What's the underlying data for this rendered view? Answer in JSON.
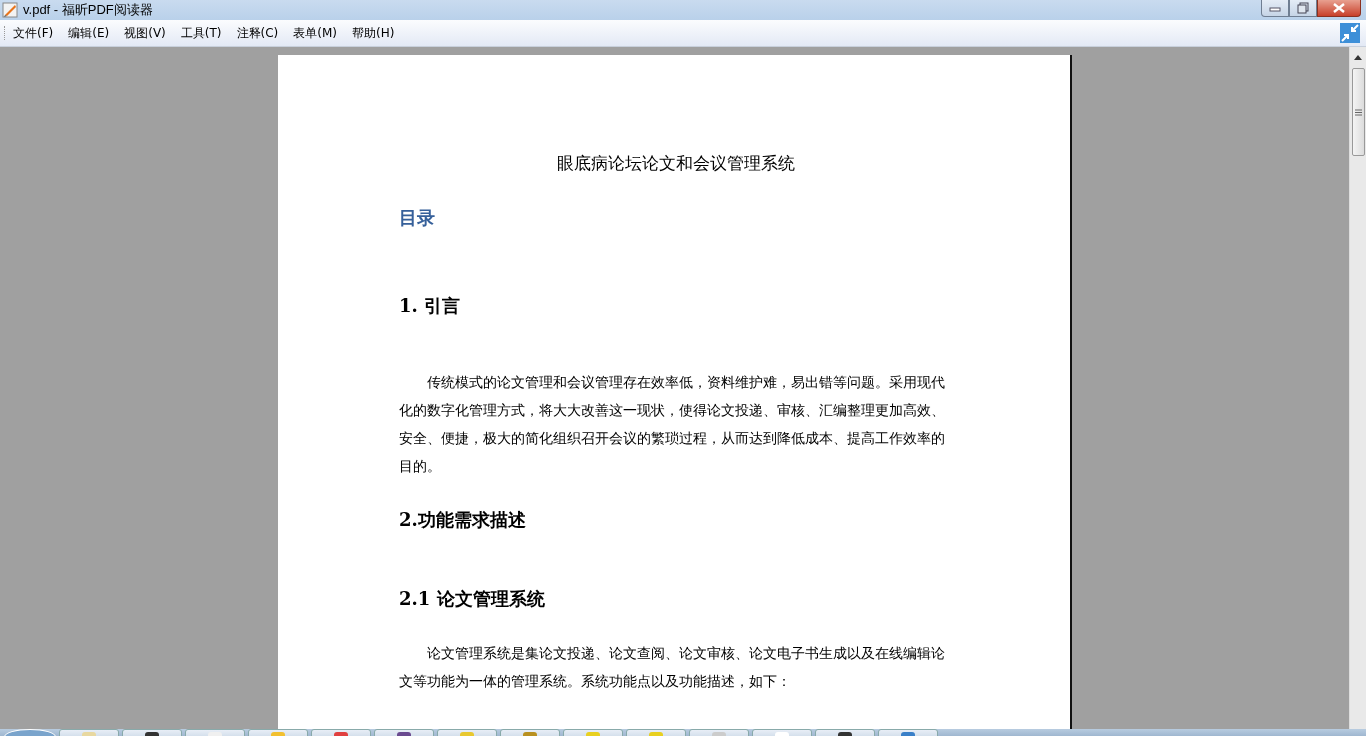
{
  "window": {
    "title": "v.pdf - 福昕PDF阅读器"
  },
  "menu": [
    {
      "label": "文件(F)"
    },
    {
      "label": "编辑(E)"
    },
    {
      "label": "视图(V)"
    },
    {
      "label": "工具(T)"
    },
    {
      "label": "注释(C)"
    },
    {
      "label": "表单(M)"
    },
    {
      "label": "帮助(H)"
    }
  ],
  "document": {
    "title": "眼底病论坛论文和会议管理系统",
    "toc_heading": "目录",
    "blocks": [
      {
        "kind": "heading",
        "text": "1. 引言"
      },
      {
        "kind": "paragraph",
        "text": "传统模式的论文管理和会议管理存在效率低，资料维护难，易出错等问题。采用现代化的数字化管理方式，将大大改善这一现状，使得论文投递、审核、汇编整理更加高效、安全、便捷，极大的简化组织召开会议的繁琐过程，从而达到降低成本、提高工作效率的目的。"
      },
      {
        "kind": "heading",
        "text": "2.功能需求描述"
      },
      {
        "kind": "heading",
        "text": "2.1 论文管理系统"
      },
      {
        "kind": "paragraph",
        "text": "论文管理系统是集论文投递、论文查阅、论文审核、论文电子书生成以及在线编辑论文等功能为一体的管理系统。系统功能点以及功能描述，如下："
      }
    ]
  }
}
